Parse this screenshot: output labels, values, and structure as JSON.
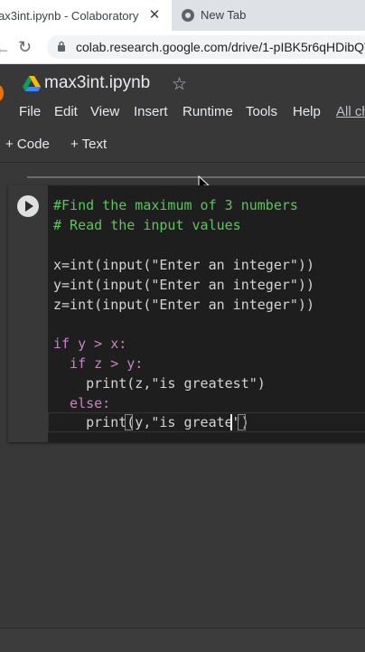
{
  "browser": {
    "tabs": [
      {
        "title": "ax3int.ipynb - Colaboratory",
        "close": "✕"
      },
      {
        "title": "New Tab"
      }
    ],
    "url": "colab.research.google.com/drive/1-pIBK5r6qHDibQV"
  },
  "notebook": {
    "title": "max3int.ipynb",
    "star": "☆",
    "menu": [
      "File",
      "Edit",
      "View",
      "Insert",
      "Runtime",
      "Tools",
      "Help",
      "All ch"
    ],
    "toolbar": {
      "add_code": "+ Code",
      "add_text": "+ Text"
    }
  },
  "code": {
    "line1": "#Find the maximum of 3 numbers",
    "line2": "# Read the input values",
    "line3": "x=int(input(\"Enter an integer\"))",
    "line4": "y=int(input(\"Enter an integer\"))",
    "line5": "z=int(input(\"Enter an integer\"))",
    "line6": "if y > x:",
    "line7": "  if z > y:",
    "line8": "    print(z,\"is greatest\")",
    "line9": "  else:",
    "line10": "    print(y,\"is greate\")"
  },
  "colors": {
    "comment": "#5ec45e",
    "keyword": "#c586c0",
    "string": "#ce9178"
  }
}
